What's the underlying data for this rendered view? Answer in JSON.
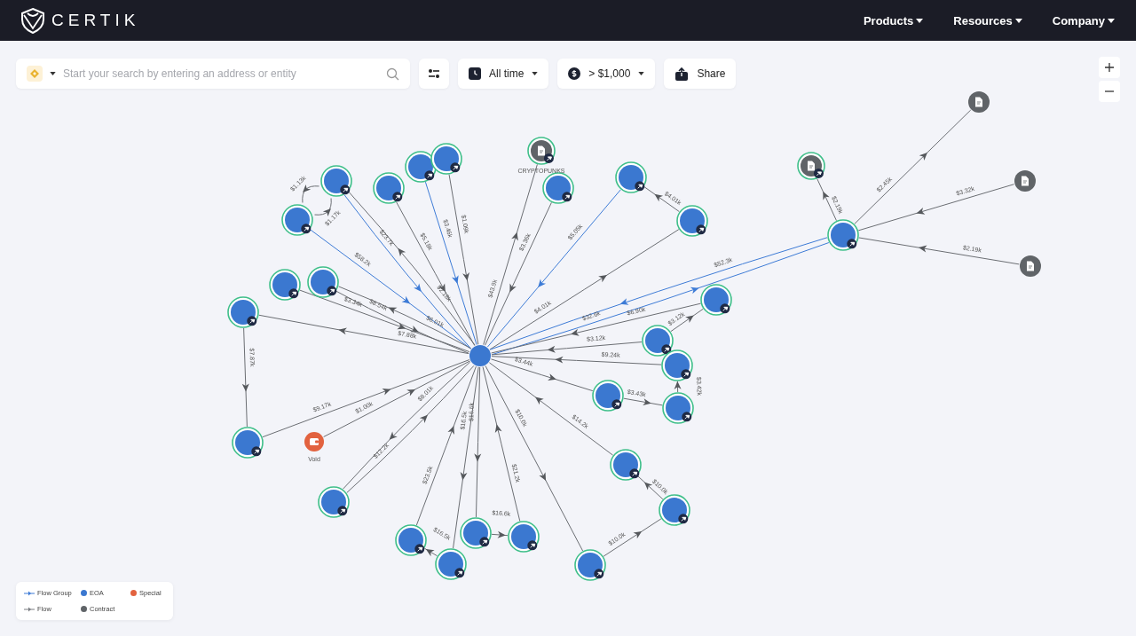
{
  "header": {
    "logo": "CERTIK",
    "nav": [
      {
        "label": "Products"
      },
      {
        "label": "Resources"
      },
      {
        "label": "Company"
      }
    ]
  },
  "toolbar": {
    "search": {
      "placeholder": "Start your search by entering an address or entity"
    },
    "time_filter": "All time",
    "amount_filter": "> $1,000",
    "share": "Share"
  },
  "graph": {
    "nodes": [
      {
        "kind": "eoa",
        "pinned": false
      },
      {
        "kind": "eoa",
        "pinned": true
      },
      {
        "kind": "eoa",
        "pinned": true
      },
      {
        "kind": "eoa",
        "pinned": true
      },
      {
        "kind": "eoa",
        "pinned": true
      },
      {
        "kind": "eoa",
        "pinned": true
      },
      {
        "kind": "contract",
        "pinned": true,
        "label": "CRYPTOPUNKS"
      },
      {
        "kind": "eoa",
        "pinned": true
      },
      {
        "kind": "eoa",
        "pinned": true
      },
      {
        "kind": "eoa",
        "pinned": true
      },
      {
        "kind": "eoa",
        "pinned": true
      },
      {
        "kind": "contract",
        "pinned": true
      },
      {
        "kind": "contract",
        "pinned": false
      },
      {
        "kind": "contract",
        "pinned": false
      },
      {
        "kind": "contract",
        "pinned": false
      },
      {
        "kind": "eoa",
        "pinned": true
      },
      {
        "kind": "eoa",
        "pinned": true
      },
      {
        "kind": "eoa",
        "pinned": true
      },
      {
        "kind": "eoa",
        "pinned": true
      },
      {
        "kind": "eoa",
        "pinned": true
      },
      {
        "kind": "eoa",
        "pinned": true
      },
      {
        "kind": "eoa",
        "pinned": true
      },
      {
        "kind": "eoa",
        "pinned": true
      },
      {
        "kind": "eoa",
        "pinned": true
      },
      {
        "kind": "eoa",
        "pinned": true
      },
      {
        "kind": "eoa",
        "pinned": true
      },
      {
        "kind": "eoa",
        "pinned": true
      },
      {
        "kind": "eoa",
        "pinned": true
      },
      {
        "kind": "special",
        "pinned": false,
        "label": "Void"
      },
      {
        "kind": "eoa",
        "pinned": true
      },
      {
        "kind": "eoa",
        "pinned": true
      },
      {
        "kind": "eoa",
        "pinned": true
      },
      {
        "kind": "eoa",
        "pinned": true
      }
    ],
    "edges": [
      {
        "amount": "$1.17k",
        "kind": "flow"
      },
      {
        "amount": "$1.13k",
        "kind": "flow"
      },
      {
        "amount": "$23.7k",
        "kind": "flow_group"
      },
      {
        "amount": "$2.18k",
        "kind": "flow"
      },
      {
        "amount": "$5.18k",
        "kind": "flow"
      },
      {
        "amount": "$3.46k",
        "kind": "flow_group"
      },
      {
        "amount": "$1.09k",
        "kind": "flow"
      },
      {
        "amount": "$58.2k",
        "kind": "flow_group"
      },
      {
        "amount": "$8.54k",
        "kind": "flow"
      },
      {
        "amount": "$3.34k",
        "kind": "flow"
      },
      {
        "amount": "$6.01k",
        "kind": "flow"
      },
      {
        "amount": "$7.88k",
        "kind": "flow"
      },
      {
        "amount": "$7.87k",
        "kind": "flow"
      },
      {
        "amount": "$43.9k",
        "kind": "flow"
      },
      {
        "amount": "$3.36k",
        "kind": "flow"
      },
      {
        "amount": "$5.05k",
        "kind": "flow_group"
      },
      {
        "amount": "$4.01k",
        "kind": "flow"
      },
      {
        "amount": "$4.01k",
        "kind": "flow"
      },
      {
        "amount": "$32.6k",
        "kind": "flow_group"
      },
      {
        "amount": "$52.3k",
        "kind": "flow_group"
      },
      {
        "amount": "$2.19k",
        "kind": "flow"
      },
      {
        "amount": "$2.45k",
        "kind": "flow"
      },
      {
        "amount": "$3.32k",
        "kind": "flow"
      },
      {
        "amount": "$2.19k",
        "kind": "flow"
      },
      {
        "amount": "$6.90k",
        "kind": "flow"
      },
      {
        "amount": "$3.12k",
        "kind": "flow"
      },
      {
        "amount": "$3.12k",
        "kind": "flow"
      },
      {
        "amount": "$9.24k",
        "kind": "flow"
      },
      {
        "amount": "$3.44k",
        "kind": "flow"
      },
      {
        "amount": "$3.43k",
        "kind": "flow"
      },
      {
        "amount": "$3.42k",
        "kind": "flow"
      },
      {
        "amount": "$14.2k",
        "kind": "flow"
      },
      {
        "amount": "$10.0k",
        "kind": "flow"
      },
      {
        "amount": "$10.0k",
        "kind": "flow"
      },
      {
        "amount": "$10.0k",
        "kind": "flow"
      },
      {
        "amount": "$21.2k",
        "kind": "flow"
      },
      {
        "amount": "$16.6k",
        "kind": "flow"
      },
      {
        "amount": "$16.6k",
        "kind": "flow"
      },
      {
        "amount": "$16.5k",
        "kind": "flow"
      },
      {
        "amount": "$16.5k",
        "kind": "flow"
      },
      {
        "amount": "$23.5k",
        "kind": "flow"
      },
      {
        "amount": "$12.2k",
        "kind": "flow"
      },
      {
        "amount": "$8.01k",
        "kind": "flow"
      },
      {
        "amount": "$9.17k",
        "kind": "flow"
      },
      {
        "amount": "$1.00k",
        "kind": "flow"
      }
    ]
  },
  "legend": [
    {
      "label": "Flow Group",
      "kind": "line",
      "color": "#3d7bd6"
    },
    {
      "label": "EOA",
      "kind": "dot",
      "color": "#3b78d0"
    },
    {
      "label": "Special",
      "kind": "dot",
      "color": "#e2623f"
    },
    {
      "label": "Flow",
      "kind": "line",
      "color": "#7a7d82"
    },
    {
      "label": "Contract",
      "kind": "dot",
      "color": "#606468"
    }
  ]
}
